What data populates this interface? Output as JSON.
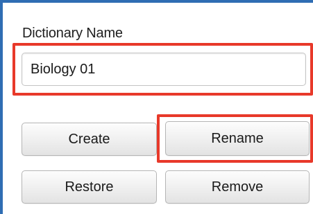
{
  "dictionary": {
    "label": "Dictionary Name",
    "value": "Biology 01"
  },
  "buttons": {
    "create": "Create",
    "rename": "Rename",
    "restore": "Restore",
    "remove": "Remove"
  },
  "colors": {
    "highlight": "#e8392a",
    "frame_border": "#2f6db3"
  }
}
